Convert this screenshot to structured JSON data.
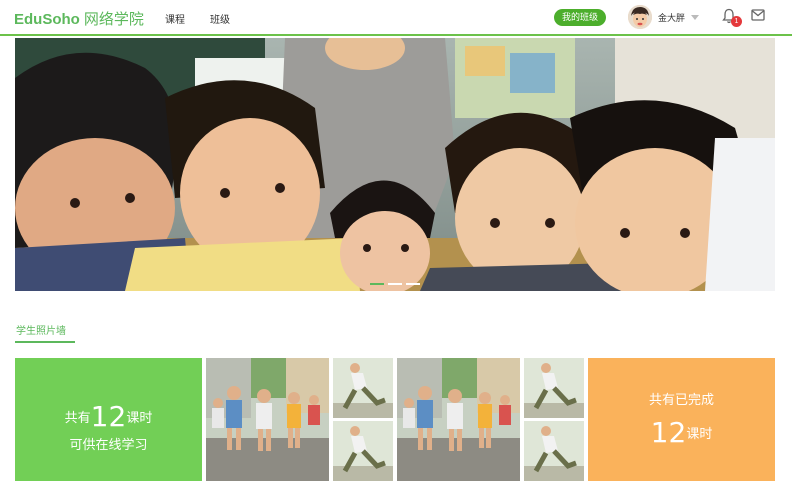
{
  "header": {
    "logo_en": "EduSoho",
    "logo_cn": "网络学院",
    "nav": [
      {
        "label": "课程"
      },
      {
        "label": "班级"
      }
    ],
    "my_class_button": "我的班级",
    "user_name": "金大胖",
    "notification_count": "1",
    "accent_color": "#5cb85c"
  },
  "carousel": {
    "slide_count": 3,
    "active_index": 0,
    "image_description_icon": "classroom-children-photo"
  },
  "photo_wall": {
    "title": "学生照片墙",
    "stat_left": {
      "prefix": "共有",
      "number": "12",
      "suffix": "课时",
      "line2": "可供在线学习",
      "color": "#72cf56"
    },
    "stat_right": {
      "line1": "共有已完成",
      "number": "12",
      "suffix": "课时",
      "color": "#fab25b"
    }
  }
}
